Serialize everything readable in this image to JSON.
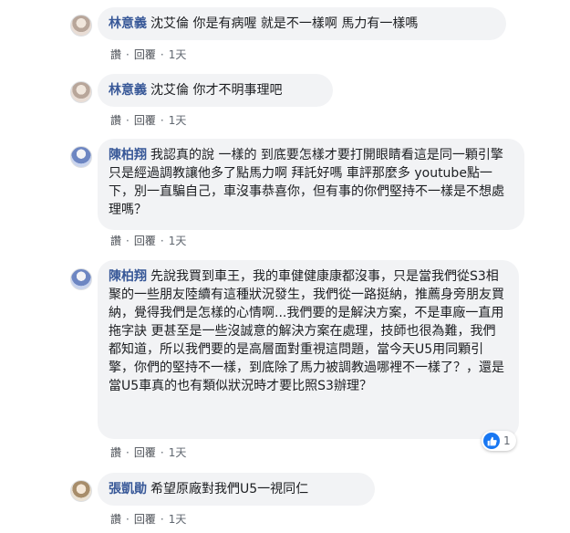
{
  "actions": {
    "like": "讚",
    "reply": "回覆",
    "sep": "·"
  },
  "comments": [
    {
      "author": "林意義",
      "text": "沈艾倫 你是有病喔 就是不一樣啊 馬力有一樣嗎",
      "time": "1天"
    },
    {
      "author": "林意義",
      "text": "沈艾倫 你才不明事理吧",
      "time": "1天"
    },
    {
      "author": "陳柏翔",
      "text": "我認真的說 一樣的 到底要怎樣才要打開眼睛看這是同一顆引擎 只是經過調教讓他多了點馬力啊 拜託好嗎 車評那麼多 youtube點一下，別一直騙自己，車沒事恭喜你，但有事的你們堅持不一樣是不想處理嗎？",
      "time": "1天"
    },
    {
      "author": "陳柏翔",
      "text": "先說我買到車王，我的車健健康康都沒事，只是當我們從S3相聚的一些朋友陸續有這種狀況發生，我們從一路挺納，推薦身旁朋友買納，覺得我們是怎樣的心情啊...我們要的是解決方案，不是車廠一直用拖字訣 更甚至是一些沒誠意的解決方案在處理，技師也很為難，我們都知道，所以我們要的是高層面對重視這問題，當今天U5用同顆引擎，你們的堅持不一樣，到底除了馬力被調教過哪裡不一樣了？，還是當U5車真的也有類似狀況時才要比照S3辦理？",
      "time": "1天",
      "reaction_count": "1"
    },
    {
      "author": "張凱勛",
      "text": "希望原廠對我們U5一視同仁",
      "time": "1天"
    }
  ]
}
